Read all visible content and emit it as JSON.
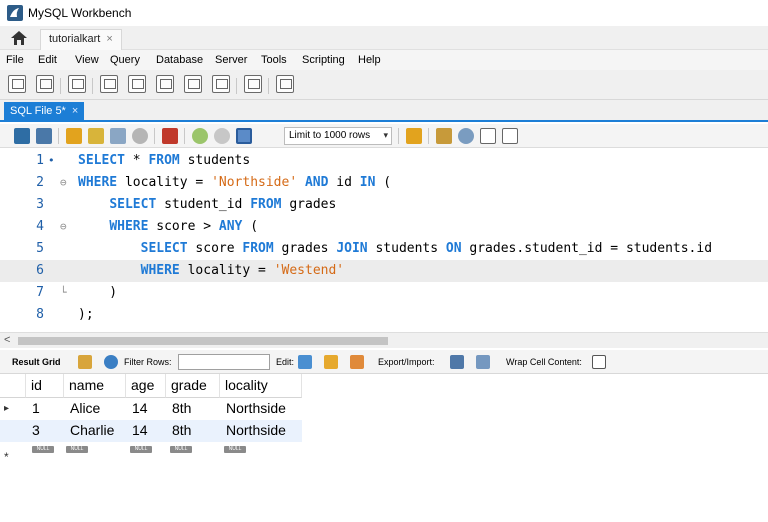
{
  "window": {
    "title": "MySQL Workbench"
  },
  "connection_tab": {
    "label": "tutorialkart",
    "close": "×"
  },
  "menu": [
    "File",
    "Edit",
    "View",
    "Query",
    "Database",
    "Server",
    "Tools",
    "Scripting",
    "Help"
  ],
  "sql_tab": {
    "label": "SQL File 5*",
    "close": "×"
  },
  "editor_toolbar": {
    "limit_label": "Limit to 1000 rows",
    "limit_arrow": "▾"
  },
  "editor": {
    "lines": [
      {
        "num": "1",
        "marker": "•",
        "tokens": [
          [
            "kw",
            "SELECT"
          ],
          [
            "plain",
            " * "
          ],
          [
            "kw",
            "FROM"
          ],
          [
            "plain",
            " students"
          ]
        ]
      },
      {
        "num": "2",
        "marker": "⊖",
        "tokens": [
          [
            "kw",
            "WHERE"
          ],
          [
            "plain",
            " locality = "
          ],
          [
            "str",
            "'Northside'"
          ],
          [
            "plain",
            " "
          ],
          [
            "kw",
            "AND"
          ],
          [
            "plain",
            " id "
          ],
          [
            "kw",
            "IN"
          ],
          [
            "plain",
            " ("
          ]
        ]
      },
      {
        "num": "3",
        "marker": "",
        "tokens": [
          [
            "plain",
            "    "
          ],
          [
            "kw",
            "SELECT"
          ],
          [
            "plain",
            " student_id "
          ],
          [
            "kw",
            "FROM"
          ],
          [
            "plain",
            " grades"
          ]
        ]
      },
      {
        "num": "4",
        "marker": "⊖",
        "tokens": [
          [
            "plain",
            "    "
          ],
          [
            "kw",
            "WHERE"
          ],
          [
            "plain",
            " score > "
          ],
          [
            "kw",
            "ANY"
          ],
          [
            "plain",
            " ("
          ]
        ]
      },
      {
        "num": "5",
        "marker": "",
        "tokens": [
          [
            "plain",
            "        "
          ],
          [
            "kw",
            "SELECT"
          ],
          [
            "plain",
            " score "
          ],
          [
            "kw",
            "FROM"
          ],
          [
            "plain",
            " grades "
          ],
          [
            "kw",
            "JOIN"
          ],
          [
            "plain",
            " students "
          ],
          [
            "kw",
            "ON"
          ],
          [
            "plain",
            " grades.student_id = students.id"
          ]
        ]
      },
      {
        "num": "6",
        "marker": "",
        "tokens": [
          [
            "plain",
            "        "
          ],
          [
            "kw",
            "WHERE"
          ],
          [
            "plain",
            " locality = "
          ],
          [
            "str",
            "'Westend'"
          ]
        ]
      },
      {
        "num": "7",
        "marker": "└",
        "tokens": [
          [
            "plain",
            "    )"
          ]
        ]
      },
      {
        "num": "8",
        "marker": "",
        "tokens": [
          [
            "plain",
            ");"
          ]
        ]
      }
    ],
    "highlighted_line": 6
  },
  "result_toolbar": {
    "result_grid": "Result Grid",
    "filter_rows": "Filter Rows:",
    "edit": "Edit:",
    "export_import": "Export/Import:",
    "wrap_cell": "Wrap Cell Content:"
  },
  "grid": {
    "columns": [
      "id",
      "name",
      "age",
      "grade",
      "locality"
    ],
    "rows": [
      [
        "1",
        "Alice",
        "14",
        "8th",
        "Northside"
      ],
      [
        "3",
        "Charlie",
        "14",
        "8th",
        "Northside"
      ]
    ],
    "null_label": "NULL",
    "current_row_marker": "▸",
    "new_row_marker": "*"
  },
  "colors": {
    "accent": "#1c7ed6",
    "keyword": "#1f7ad6",
    "string": "#d56a16"
  }
}
